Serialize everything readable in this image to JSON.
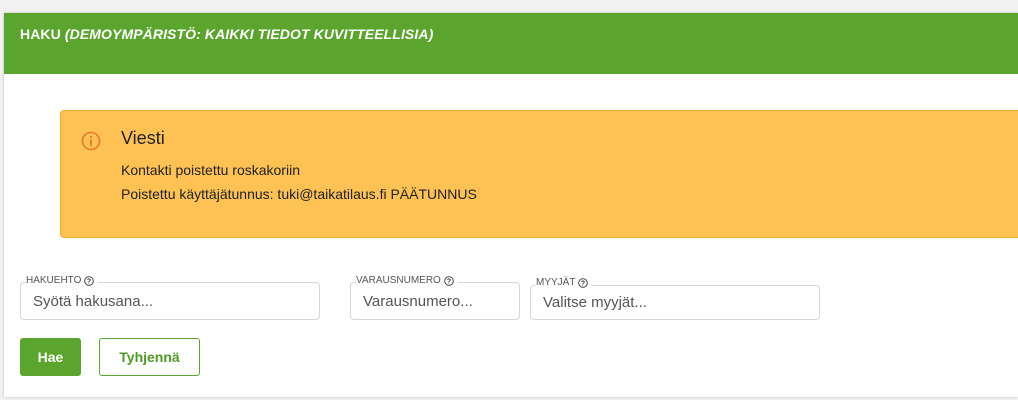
{
  "header": {
    "title": "HAKU",
    "subtitle": "(DEMOYMPÄRISTÖ: KAIKKI TIEDOT KUVITTEELLISIA)",
    "color": "#5ba52e"
  },
  "alert": {
    "icon": "info-icon",
    "title": "Viesti",
    "lines": [
      "Kontakti poistettu roskakoriin",
      "Poistettu käyttäjätunnus: tuki@taikatilaus.fi PÄÄTUNNUS"
    ],
    "background": "#fdc253"
  },
  "form": {
    "hakuehto": {
      "label": "HAKUEHTO",
      "placeholder": "Syötä hakusana...",
      "value": ""
    },
    "varausnumero": {
      "label": "VARAUSNUMERO",
      "placeholder": "Varausnumero...",
      "value": ""
    },
    "myyjat": {
      "label": "MYYJÄT",
      "placeholder": "Valitse myyjät...",
      "value": ""
    }
  },
  "buttons": {
    "search": "Hae",
    "clear": "Tyhjennä"
  }
}
